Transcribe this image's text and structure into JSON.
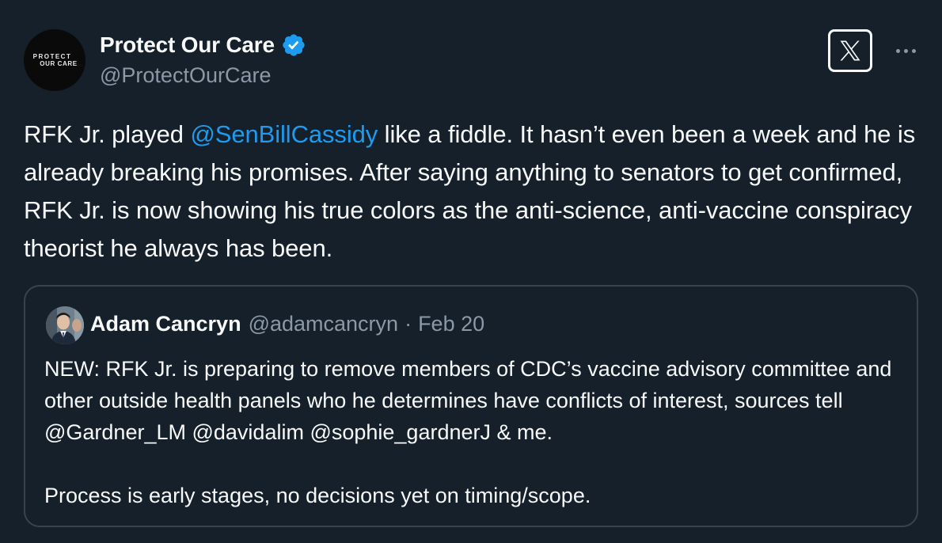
{
  "author": {
    "display_name": "Protect Our Care",
    "handle": "@ProtectOurCare",
    "avatar_logo_line1": "PROTECT",
    "avatar_logo_line2": "OUR CARE",
    "verified": true
  },
  "tweet": {
    "text_before_mention": "RFK Jr. played ",
    "mention": "@SenBillCassidy",
    "text_after_mention": " like a fiddle. It hasn’t even been a week and he is already breaking his promises. After saying anything to senators to get confirmed, RFK Jr. is now showing his true colors as the anti-science, anti-vaccine conspiracy theorist he always has been."
  },
  "quoted_tweet": {
    "display_name": "Adam Cancryn",
    "handle": "@adamcancryn",
    "separator": "·",
    "date": "Feb 20",
    "paragraph_1": "NEW: RFK Jr. is preparing to remove members of CDC’s vaccine advisory committee and other outside health panels who he determines have conflicts of interest, sources tell @Gardner_LM @davidalim @sophie_gardnerJ & me.",
    "paragraph_2": "Process is early stages, no decisions yet on timing/scope."
  },
  "icons": {
    "x_logo": "x-logo-icon",
    "more": "more-horizontal-icon",
    "verified": "verified-badge-icon"
  },
  "colors": {
    "background": "#15202b",
    "text_primary": "#f7f9f9",
    "text_secondary": "#8b98a5",
    "mention": "#1d9bf0",
    "verified": "#1d9bf0",
    "border": "#38444d"
  }
}
